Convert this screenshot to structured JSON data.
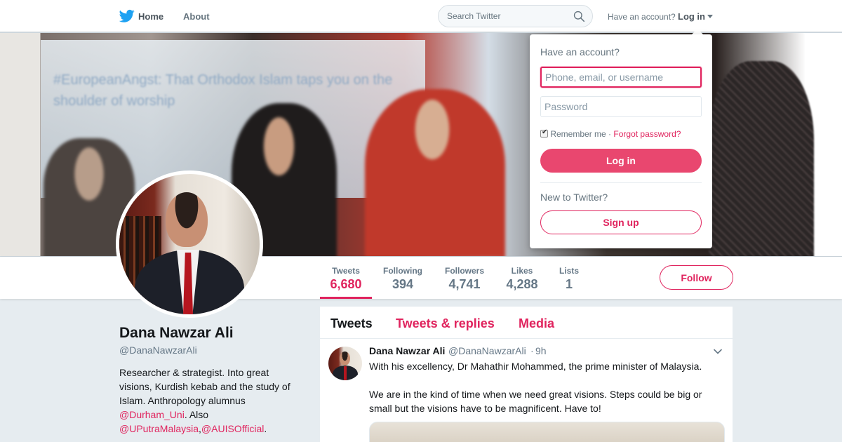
{
  "topnav": {
    "home_label": "Home",
    "about_label": "About",
    "search_placeholder": "Search Twitter",
    "have_account": "Have an account?",
    "login_label": "Log in"
  },
  "header_photo": {
    "caption_text": "#EuropeanAngst: That Orthodox Islam taps you on the shoulder of worship"
  },
  "profile": {
    "name": "Dana Nawzar Ali",
    "handle": "@DanaNawzarAli",
    "bio_text": "Researcher & strategist. Into great visions, Kurdish kebab and the study of Islam. Anthropology alumnus ",
    "bio_link1": "@Durham_Uni",
    "bio_mid": ". Also ",
    "bio_link2": "@UPutraMalaysia",
    "bio_comma": ",",
    "bio_link3": "@AUISOfficial",
    "bio_end": "."
  },
  "stats": [
    {
      "label": "Tweets",
      "value": "6,680",
      "active": true
    },
    {
      "label": "Following",
      "value": "394",
      "active": false
    },
    {
      "label": "Followers",
      "value": "4,741",
      "active": false
    },
    {
      "label": "Likes",
      "value": "4,288",
      "active": false
    },
    {
      "label": "Lists",
      "value": "1",
      "active": false
    }
  ],
  "follow_label": "Follow",
  "timeline": {
    "tabs": [
      "Tweets",
      "Tweets & replies",
      "Media"
    ],
    "active_tab": "Tweets",
    "tweet": {
      "name": "Dana Nawzar Ali",
      "handle": "@DanaNawzarAli",
      "separator": "·",
      "time": "9h",
      "text_p1": "With his excellency,  Dr Mahathir Mohammed, the prime minister of Malaysia.",
      "text_p2": "We are in the kind of time when we need great visions. Steps could be big or small but the visions have to be magnificent. Have to!"
    }
  },
  "login_dropdown": {
    "title": "Have an account?",
    "username_placeholder": "Phone, email, or username",
    "password_placeholder": "Password",
    "remember_label": "Remember me",
    "separator": "·",
    "forgot_label": "Forgot password?",
    "login_button": "Log in",
    "new_label": "New to Twitter?",
    "signup_button": "Sign up"
  },
  "colors": {
    "accent": "#e0245e",
    "brand_blue": "#1da1f2",
    "background": "#e6ecf0"
  },
  "icons": {
    "brand": "twitter-bird-icon",
    "search": "search-icon",
    "caret": "caret-down-icon",
    "tweet_menu": "chevron-down-icon"
  }
}
